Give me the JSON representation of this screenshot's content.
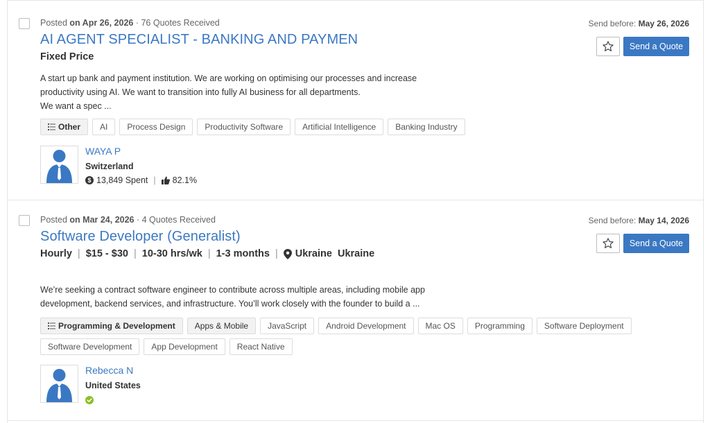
{
  "jobs": [
    {
      "posted_prefix": "Posted",
      "posted_date": "on Apr 26, 2026",
      "quotes": "· 76 Quotes Received",
      "title": "AI AGENT SPECIALIST - BANKING AND PAYMEN",
      "pricing": "Fixed Price",
      "description": [
        "A start up bank and payment institution. We are working on optimising our processes and increase",
        "productivity using AI. We want to transition into fully AI business for all departments.",
        "We want a spec ..."
      ],
      "category": "Other",
      "tags": [
        "AI",
        "Process Design",
        "Productivity Software",
        "Artificial Intelligence",
        "Banking Industry"
      ],
      "client": {
        "name": "WAYA P",
        "country": "Switzerland",
        "spent": "13,849 Spent",
        "rating": "82.1%"
      },
      "send_before_label": "Send before:",
      "send_before_date": "May 26, 2026",
      "quote_button": "Send a Quote"
    },
    {
      "posted_prefix": "Posted",
      "posted_date": "on Mar 24, 2026",
      "quotes": "· 4 Quotes Received",
      "title": "Software Developer (Generalist)",
      "pricing": "Hourly",
      "rate": "$15 - $30",
      "hours": "10-30 hrs/wk",
      "duration": "1-3 months",
      "location": "Ukraine  Ukraine",
      "description": [
        "We’re seeking a contract software engineer to contribute across multiple areas, including mobile app",
        "development, backend services, and infrastructure. You’ll work closely with the founder to build a ..."
      ],
      "category": "Programming & Development",
      "subcategory": "Apps & Mobile",
      "tags": [
        "JavaScript",
        "Android Development",
        "Mac OS",
        "Programming",
        "Software Deployment",
        "Software Development",
        "App Development",
        "React Native"
      ],
      "client": {
        "name": "Rebecca N",
        "country": "United States"
      },
      "send_before_label": "Send before:",
      "send_before_date": "May 14, 2026",
      "quote_button": "Send a Quote"
    }
  ],
  "icons": {
    "checkbox": "checkbox-icon",
    "star": "star-icon",
    "list": "list-icon",
    "dollar": "dollar-icon",
    "thumb": "thumbs-up-icon",
    "pin": "map-pin-icon",
    "verified": "verified-check-icon",
    "avatar": "user-avatar-icon"
  },
  "colors": {
    "link": "#3b78c3",
    "button": "#3b78c3",
    "verified": "#8cbf26"
  }
}
